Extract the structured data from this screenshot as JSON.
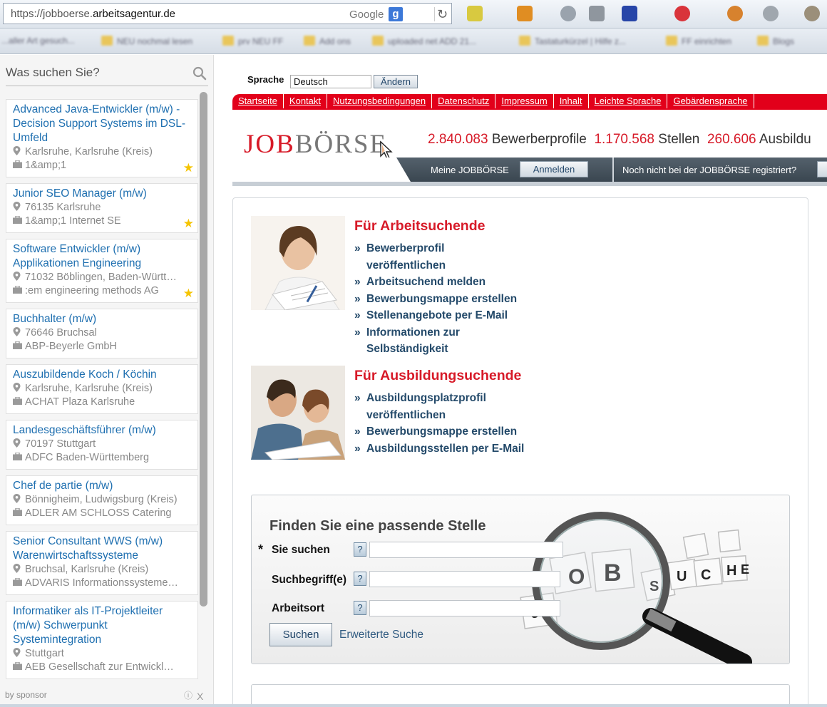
{
  "browser": {
    "url_prefix": "https://jobboerse.",
    "url_domain": "arbeitsagentur.de",
    "search_engine": "Google",
    "search_engine_icon": "g",
    "reload_icon": "↻",
    "bookmarks": [
      "...aller Art gesuch...",
      "NEU nochmal lesen",
      "prv NEU FF",
      "Add ons",
      "uploaded net ADD 21...",
      "Tastaturkürzel | Hilfe z...",
      "FF einrichten",
      "Blogs"
    ]
  },
  "sidebar": {
    "search_placeholder": "Was suchen Sie?",
    "ads": [
      {
        "title": "Advanced Java-Entwickler (m/w) - Decision Support Systems im DSL-Umfeld",
        "location": "Karlsruhe, Karlsruhe (Kreis)",
        "company": "1&amp;1",
        "starred": true
      },
      {
        "title": "Junior SEO Manager (m/w)",
        "location": "76135 Karlsruhe",
        "company": "1&amp;1 Internet SE",
        "starred": true
      },
      {
        "title": "Software Entwickler (m/w) Applikationen Engineering",
        "location": "71032 Böblingen, Baden-Württemberg",
        "company": ":em engineering methods AG",
        "starred": true
      },
      {
        "title": "Buchhalter (m/w)",
        "location": "76646 Bruchsal",
        "company": "ABP-Beyerle GmbH",
        "starred": false
      },
      {
        "title": "Auszubildende Koch / Köchin",
        "location": "Karlsruhe, Karlsruhe (Kreis)",
        "company": "ACHAT Plaza Karlsruhe",
        "starred": false
      },
      {
        "title": "Landesgeschäftsführer (m/w)",
        "location": "70197 Stuttgart",
        "company": "ADFC Baden-Württemberg",
        "starred": false
      },
      {
        "title": "Chef de partie (m/w)",
        "location": "Bönnigheim, Ludwigsburg (Kreis)",
        "company": "ADLER AM SCHLOSS Catering",
        "starred": false
      },
      {
        "title": "Senior Consultant WWS (m/w) Warenwirtschaftssysteme",
        "location": "Bruchsal, Karlsruhe (Kreis)",
        "company": "ADVARIS Informationssysteme GmbH",
        "starred": false
      },
      {
        "title": "Informatiker als IT-Projektleiter (m/w) Schwerpunkt Systemintegration",
        "location": "Stuttgart",
        "company": "AEB Gesellschaft zur Entwicklung",
        "starred": false
      }
    ],
    "star_glyph": "★",
    "sponsor_label": "by sponsor",
    "info_glyph": "ⓘ",
    "close_glyph": "X"
  },
  "main": {
    "language_label": "Sprache",
    "language_value": "Deutsch",
    "language_button": "Ändern",
    "nav": [
      "Startseite",
      "Kontakt",
      "Nutzungsbedingungen",
      "Datenschutz",
      "Impressum",
      "Inhalt",
      "Leichte Sprache",
      "Gebärdensprache"
    ],
    "logo_job": "JOB",
    "logo_boerse": "BÖRSE",
    "stats": [
      {
        "number": "2.840.083",
        "label": "Bewerberprofile"
      },
      {
        "number": "1.170.568",
        "label": "Stellen"
      },
      {
        "number": "260.606",
        "label": "Ausbildu"
      }
    ],
    "meine_label": "Meine JOBBÖRSE",
    "login_button": "Anmelden",
    "register_text": "Noch nicht bei der JOBBÖRSE registriert?",
    "section1": {
      "title": "Für Arbeitsuchende",
      "items": [
        "Bewerberprofil veröffentlichen",
        "Arbeitsuchend melden",
        "Bewerbungsmappe erstellen",
        "Stellenangebote per E-Mail",
        "Informationen zur Selbständigkeit"
      ]
    },
    "section2": {
      "title": "Für Ausbildungsuchende",
      "items": [
        "Ausbildungsplatzprofil veröffentlichen",
        "Bewerbungsmappe erstellen",
        "Ausbildungsstellen per E-Mail"
      ]
    },
    "search": {
      "title": "Finden Sie eine passende Stelle",
      "required_mark": "*",
      "field1_label": "Sie suchen",
      "field2_label": "Suchbegriff(e)",
      "field3_label": "Arbeitsort",
      "help_glyph": "?",
      "submit": "Suchen",
      "advanced": "Erweiterte Suche",
      "dice_letters": [
        "O",
        "B",
        "S",
        "U",
        "C",
        "H",
        "E",
        "J"
      ]
    }
  }
}
